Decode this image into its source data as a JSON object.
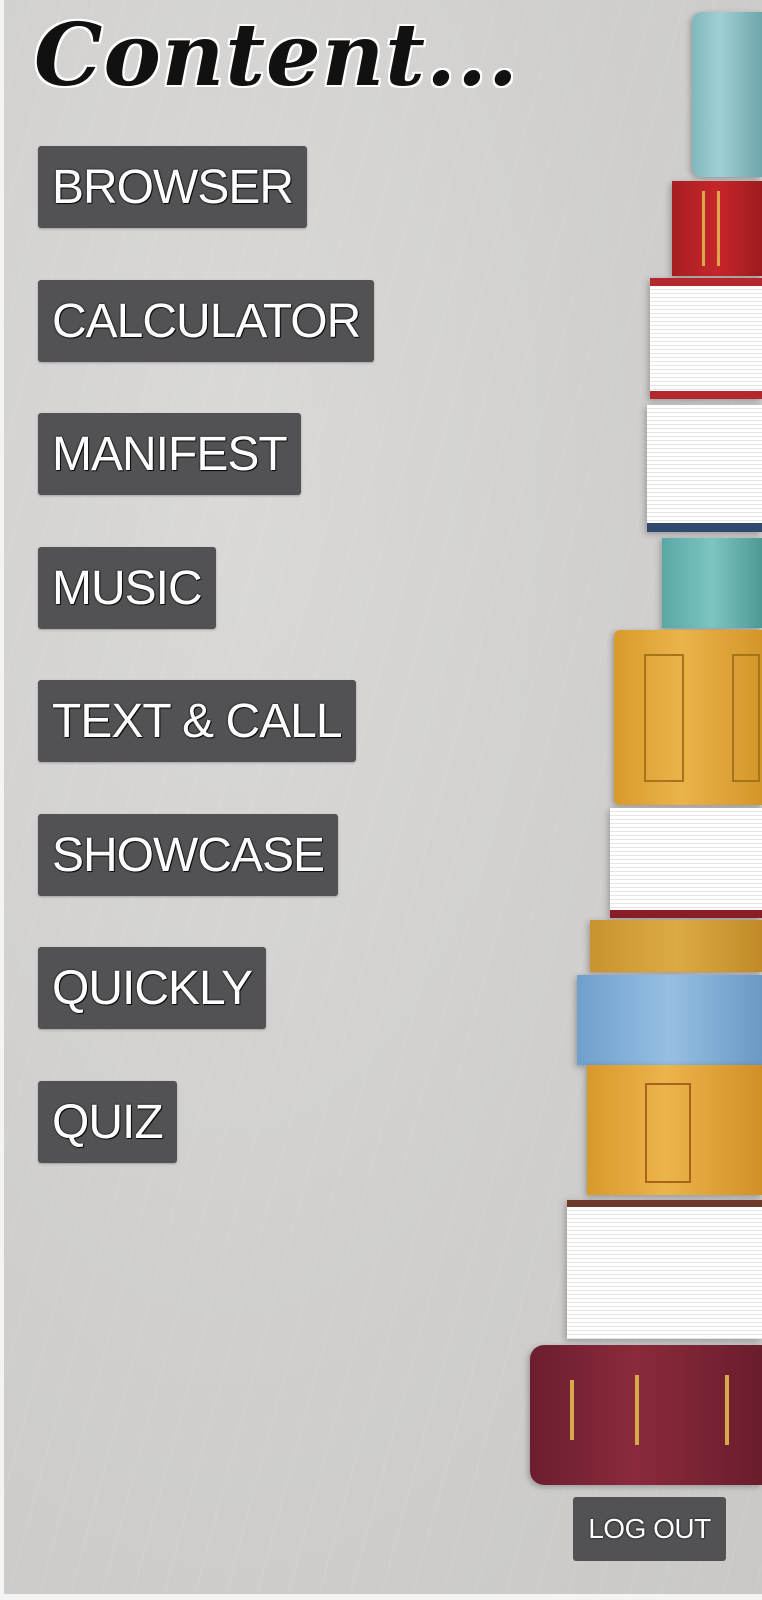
{
  "header": {
    "title": "Content..."
  },
  "menu": {
    "items": [
      {
        "label": "BROWSER"
      },
      {
        "label": "CALCULATOR"
      },
      {
        "label": "MANIFEST"
      },
      {
        "label": "MUSIC"
      },
      {
        "label": "TEXT & CALL"
      },
      {
        "label": "SHOWCASE"
      },
      {
        "label": "QUICKLY"
      },
      {
        "label": "QUIZ"
      }
    ]
  },
  "footer": {
    "logout_label": "LOG OUT"
  },
  "decoration": {
    "image": "stack-of-books"
  }
}
